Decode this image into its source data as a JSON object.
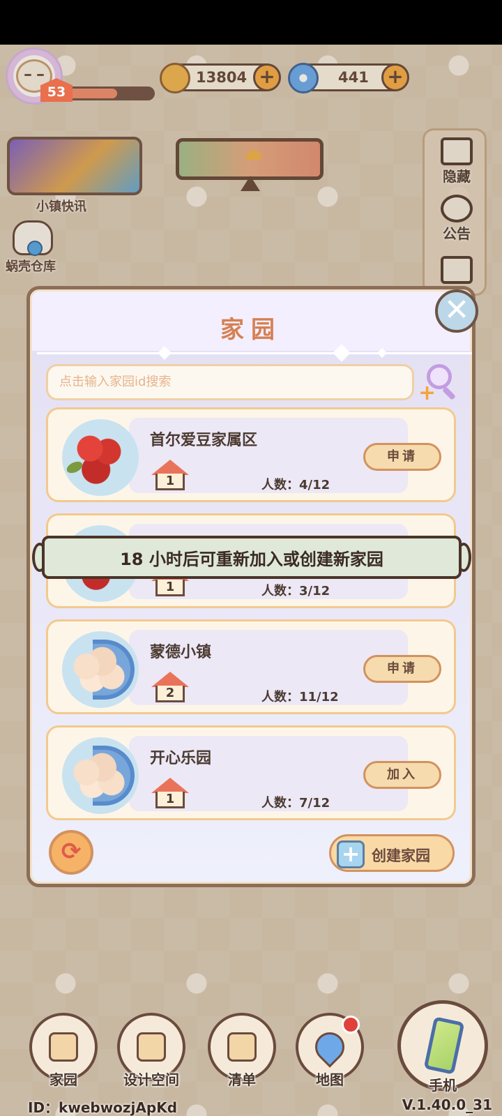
{
  "hud": {
    "level": "53",
    "xp_progress": 0.6,
    "coins": "13804",
    "shells": "441",
    "plus_symbol": "+"
  },
  "left_menu": {
    "news_label": "小镇快讯",
    "warehouse_label": "蜗壳仓库"
  },
  "right_menu": {
    "hide_label": "隐藏",
    "notice_label": "公告"
  },
  "modal": {
    "title": "家园",
    "close_symbol": "✕",
    "search_placeholder": "点击输入家园id搜索",
    "homes": [
      {
        "name": "首尔爱豆家属区",
        "level": "1",
        "count": "人数：4/12",
        "action": "申请",
        "emblem": "rose"
      },
      {
        "name": "",
        "level": "1",
        "count": "人数：3/12",
        "action": "",
        "emblem": "rose"
      },
      {
        "name": "蒙德小镇",
        "level": "2",
        "count": "人数：11/12",
        "action": "申请",
        "emblem": "cloud"
      },
      {
        "name": "开心乐园",
        "level": "1",
        "count": "人数：7/12",
        "action": "加入",
        "emblem": "cloud"
      }
    ],
    "toast": "18 小时后可重新加入或创建新家园",
    "refresh_symbol": "⟳",
    "create_label": "创建家园",
    "create_symbol": "+"
  },
  "bottom_nav": {
    "home": "家园",
    "design": "设计空间",
    "list": "清单",
    "map": "地图",
    "phone": "手机"
  },
  "footer": {
    "player_id": "ID：kwebwozjApKd",
    "version": "V.1.40.0_31"
  },
  "colors": {
    "accent_orange": "#d68053",
    "panel_border": "#8c6e58",
    "toast_bg": "#dfe8d9"
  }
}
